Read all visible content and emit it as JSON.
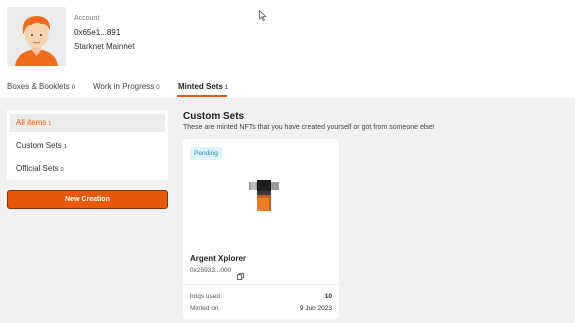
{
  "account": {
    "label": "Account",
    "address": "0x65e1...891",
    "network": "Starknet Mainnet"
  },
  "tabs": [
    {
      "label": "Boxes & Booklets",
      "count": "0"
    },
    {
      "label": "Work in Progress",
      "count": "0"
    },
    {
      "label": "Minted Sets",
      "count": "1"
    }
  ],
  "sidebar": {
    "items": [
      {
        "label": "All items",
        "count": "1"
      },
      {
        "label": "Custom Sets",
        "count": "1"
      },
      {
        "label": "Official Sets",
        "count": "0"
      }
    ],
    "new_button": "New Creation"
  },
  "main": {
    "title": "Custom Sets",
    "subtitle": "These are minted NFTs that you have created yourself or got from someone else!"
  },
  "card": {
    "status": "Pending",
    "name": "Argent Xplorer",
    "address": "0x25933...000",
    "stats": [
      {
        "label": "briqs used",
        "value": "10"
      },
      {
        "label": "Minted on",
        "value": "9 Jun 2023"
      }
    ]
  },
  "colors": {
    "accent": "#e8590c",
    "badge_bg": "#dff3fb",
    "badge_text": "#1a8fc7"
  }
}
